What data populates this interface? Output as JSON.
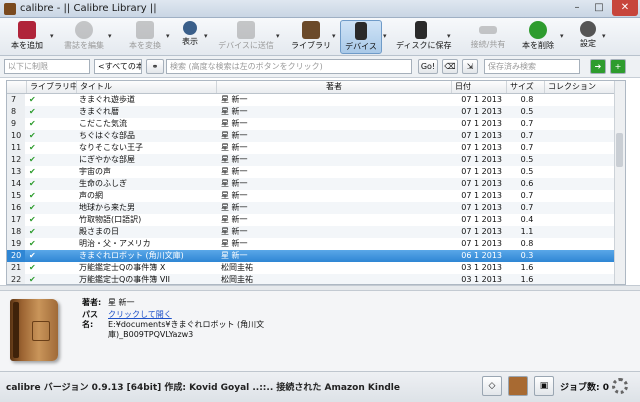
{
  "window": {
    "title": "calibre - || Calibre Library ||",
    "min": "–",
    "max": "□",
    "close": "✕"
  },
  "toolbar": {
    "buttons": [
      {
        "label": "本を追加",
        "icon": "add-book-icon",
        "color": "#b0243a",
        "disabled": false
      },
      {
        "label": "書誌を編集",
        "icon": "info-icon",
        "color": "#8a8a8a",
        "disabled": true
      },
      {
        "label": "本を変換",
        "icon": "convert-icon",
        "color": "#8a8a8a",
        "disabled": true
      },
      {
        "label": "表示",
        "icon": "magnifier-icon",
        "color": "#3a5f8a",
        "disabled": false
      },
      {
        "label": "デバイスに送信",
        "icon": "send-device-icon",
        "color": "#8a8a8a",
        "disabled": true
      },
      {
        "label": "ライブラリ",
        "icon": "library-icon",
        "color": "#6b4a2a",
        "disabled": false
      },
      {
        "label": "デバイス",
        "icon": "device-icon",
        "color": "#2a2a2a",
        "disabled": false
      },
      {
        "label": "ディスクに保存",
        "icon": "save-disk-icon",
        "color": "#2a2a2a",
        "disabled": false
      },
      {
        "label": "接続/共有",
        "icon": "connect-share-icon",
        "color": "#8a8a8a",
        "disabled": true
      },
      {
        "label": "本を削除",
        "icon": "recycle-icon",
        "color": "#2e9c2e",
        "disabled": false
      },
      {
        "label": "設定",
        "icon": "gear-icon",
        "color": "#555555",
        "disabled": false
      }
    ]
  },
  "search": {
    "restrict_placeholder": "以下に制限",
    "all_books": "<すべての本>",
    "search_placeholder": "検索 (高度な検索は左のボタンをクリック)",
    "go": "Go!",
    "saved_placeholder": "保存済み検索",
    "binoculars": "⚭"
  },
  "table": {
    "headers": {
      "library": "ライブラリ中",
      "title": "タイトル",
      "author": "著者",
      "date": "日付",
      "size": "サイズ",
      "collection": "コレクション"
    },
    "rows": [
      {
        "num": "7",
        "lib": "✔",
        "title": "きまぐれ遊歩道",
        "author": "星 新一",
        "date": "07 1 2013",
        "size": "0.8"
      },
      {
        "num": "8",
        "lib": "✔",
        "title": "きまぐれ暦",
        "author": "星 新一",
        "date": "07 1 2013",
        "size": "0.5"
      },
      {
        "num": "9",
        "lib": "✔",
        "title": "こだこた気流",
        "author": "星 新一",
        "date": "07 1 2013",
        "size": "0.7"
      },
      {
        "num": "10",
        "lib": "✔",
        "title": "ちぐはぐな部品",
        "author": "星 新一",
        "date": "07 1 2013",
        "size": "0.7"
      },
      {
        "num": "11",
        "lib": "✔",
        "title": "なりそこない王子",
        "author": "星 新一",
        "date": "07 1 2013",
        "size": "0.7"
      },
      {
        "num": "12",
        "lib": "✔",
        "title": "にぎやかな部屋",
        "author": "星 新一",
        "date": "07 1 2013",
        "size": "0.5"
      },
      {
        "num": "13",
        "lib": "✔",
        "title": "宇宙の声",
        "author": "星 新一",
        "date": "07 1 2013",
        "size": "0.5"
      },
      {
        "num": "14",
        "lib": "✔",
        "title": "生命のふしぎ",
        "author": "星 新一",
        "date": "07 1 2013",
        "size": "0.6"
      },
      {
        "num": "15",
        "lib": "✔",
        "title": "声の網",
        "author": "星 新一",
        "date": "07 1 2013",
        "size": "0.7"
      },
      {
        "num": "16",
        "lib": "✔",
        "title": "地球から来た男",
        "author": "星 新一",
        "date": "07 1 2013",
        "size": "0.7"
      },
      {
        "num": "17",
        "lib": "✔",
        "title": "竹取物語(口語訳)",
        "author": "星 新一",
        "date": "07 1 2013",
        "size": "0.4"
      },
      {
        "num": "18",
        "lib": "✔",
        "title": "殿さまの日",
        "author": "星 新一",
        "date": "07 1 2013",
        "size": "1.1"
      },
      {
        "num": "19",
        "lib": "✔",
        "title": "明治・父・アメリカ",
        "author": "星 新一",
        "date": "07 1 2013",
        "size": "0.8"
      },
      {
        "num": "20",
        "lib": "✔",
        "title": "きまぐれロボット (角川文庫)",
        "author": "星 新一",
        "date": "06 1 2013",
        "size": "0.3",
        "selected": true
      },
      {
        "num": "21",
        "lib": "✔",
        "title": "万能鑑定士Qの事件簿 X",
        "author": "松岡圭祐",
        "date": "03 1 2013",
        "size": "1.6"
      },
      {
        "num": "22",
        "lib": "✔",
        "title": "万能鑑定士Qの事件簿 VII",
        "author": "松岡圭祐",
        "date": "03 1 2013",
        "size": "1.6"
      }
    ]
  },
  "details": {
    "author_label": "著者:",
    "author_value": "星 新一",
    "path_label_1": "パス",
    "path_label_2": "名:",
    "path_link": "クリックして開く",
    "path_value_1": "E:¥documents¥きまぐれロボット (角川文",
    "path_value_2": "庫)_B009TPQVLYazw3"
  },
  "status": {
    "text": "calibre バージョン 0.9.13 [64bit] 作成: Kovid Goyal ..::.. 接続された Amazon Kindle",
    "jobs": "ジョブ数: 0"
  },
  "colors": {
    "check": "#2e9c2e",
    "selection": "#2f86d4"
  }
}
